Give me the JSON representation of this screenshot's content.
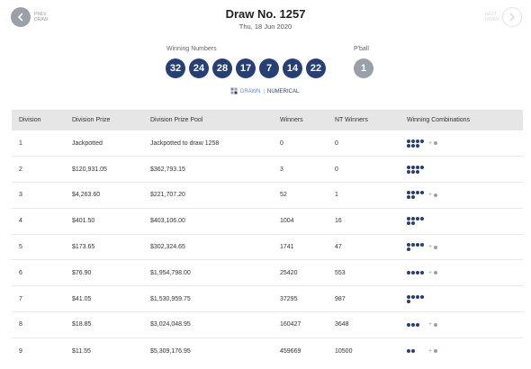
{
  "nav": {
    "prev_label_1": "PREV",
    "prev_label_2": "DRAW",
    "next_label_1": "NEXT",
    "next_label_2": "DRAW"
  },
  "header": {
    "title": "Draw No. 1257",
    "date": "Thu, 18 Jun 2020"
  },
  "winning_numbers_label": "Winning Numbers",
  "winning_numbers": [
    "32",
    "24",
    "28",
    "17",
    "7",
    "14",
    "22"
  ],
  "powerball_label": "P'ball",
  "powerball": "1",
  "sort": {
    "drawn": "DRAWN",
    "separator": "|",
    "numerical": "NUMERICAL"
  },
  "table": {
    "headers": [
      "Division",
      "Division Prize",
      "Division Prize Pool",
      "Winners",
      "NT Winners",
      "Winning Combinations"
    ],
    "rows": [
      {
        "division": "1",
        "prize": "Jackpotted",
        "pool": "Jackpotted to draw 1258",
        "winners": "0",
        "nt_winners": "0",
        "combo_main": 7,
        "combo_pb": true
      },
      {
        "division": "2",
        "prize": "$120,931.05",
        "pool": "$362,793.15",
        "winners": "3",
        "nt_winners": "0",
        "combo_main": 7,
        "combo_pb": false
      },
      {
        "division": "3",
        "prize": "$4,263.60",
        "pool": "$221,707.20",
        "winners": "52",
        "nt_winners": "1",
        "combo_main": 6,
        "combo_pb": true
      },
      {
        "division": "4",
        "prize": "$401.50",
        "pool": "$403,106.00",
        "winners": "1004",
        "nt_winners": "16",
        "combo_main": 6,
        "combo_pb": false
      },
      {
        "division": "5",
        "prize": "$173.65",
        "pool": "$302,324.65",
        "winners": "1741",
        "nt_winners": "47",
        "combo_main": 5,
        "combo_pb": true
      },
      {
        "division": "6",
        "prize": "$76.90",
        "pool": "$1,954,798.00",
        "winners": "25420",
        "nt_winners": "553",
        "combo_main": 4,
        "combo_pb": true
      },
      {
        "division": "7",
        "prize": "$41.05",
        "pool": "$1,530,959.75",
        "winners": "37295",
        "nt_winners": "987",
        "combo_main": 5,
        "combo_pb": false
      },
      {
        "division": "8",
        "prize": "$18.85",
        "pool": "$3,024,048.95",
        "winners": "160427",
        "nt_winners": "3648",
        "combo_main": 3,
        "combo_pb": true
      },
      {
        "division": "9",
        "prize": "$11.55",
        "pool": "$5,309,176.95",
        "winners": "459669",
        "nt_winners": "10500",
        "combo_main": 2,
        "combo_pb": true
      }
    ],
    "combo_plus": "+"
  },
  "colors": {
    "ball": "#263f74",
    "powerball": "#9aa0a8",
    "header_bg": "#e6e6e6"
  }
}
